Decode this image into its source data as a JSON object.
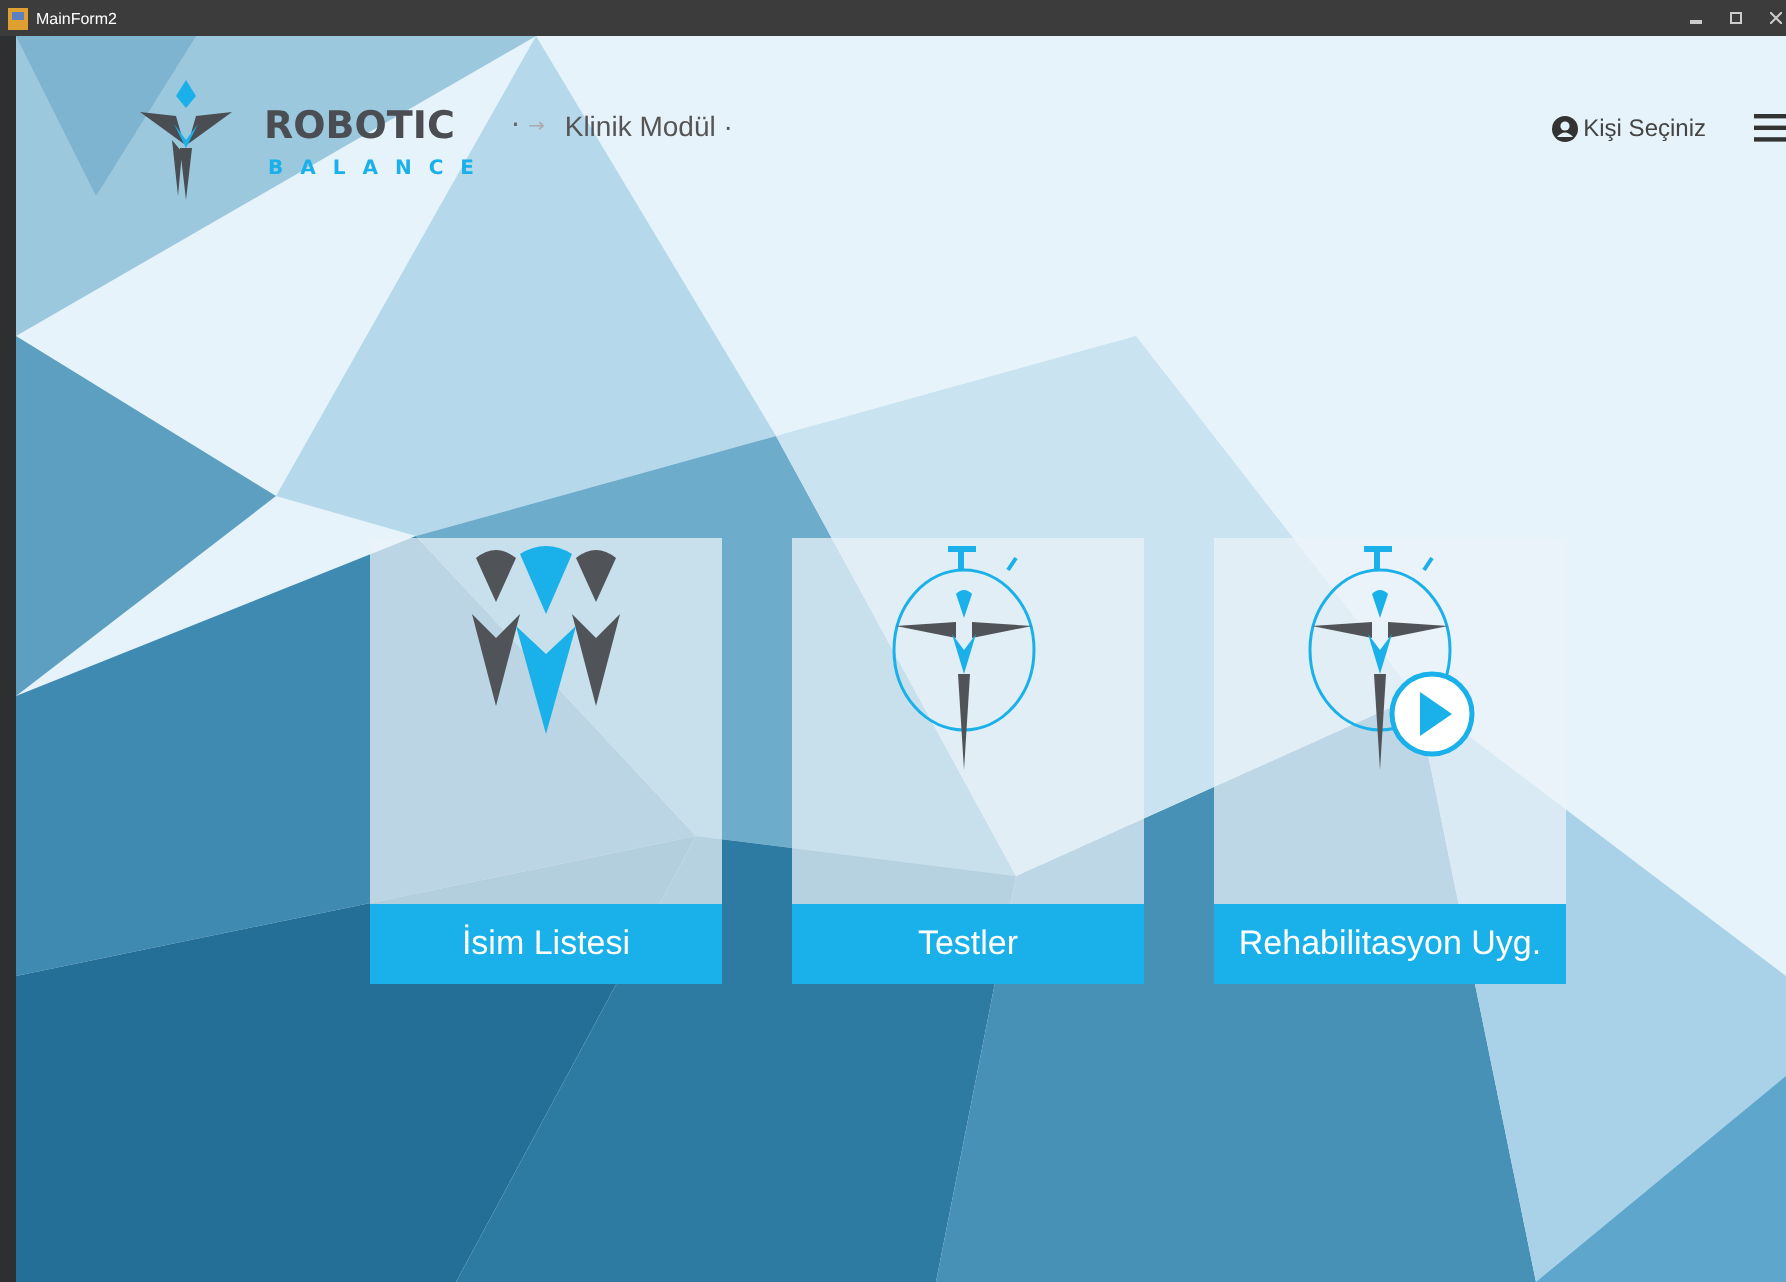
{
  "window": {
    "title": "MainForm2"
  },
  "header": {
    "brand": "ROBOTIC",
    "brand_sub": "BALANCE",
    "separator": "·",
    "arrow": "→",
    "breadcrumb": "Klinik Modül ·",
    "user_button": "Kişi Seçiniz"
  },
  "tiles": [
    {
      "label": "İsim Listesi",
      "kind": "people"
    },
    {
      "label": "Testler",
      "kind": "stopwatch"
    },
    {
      "label": "Rehabilitasyon Uyg.",
      "kind": "stopwatch-play"
    }
  ]
}
